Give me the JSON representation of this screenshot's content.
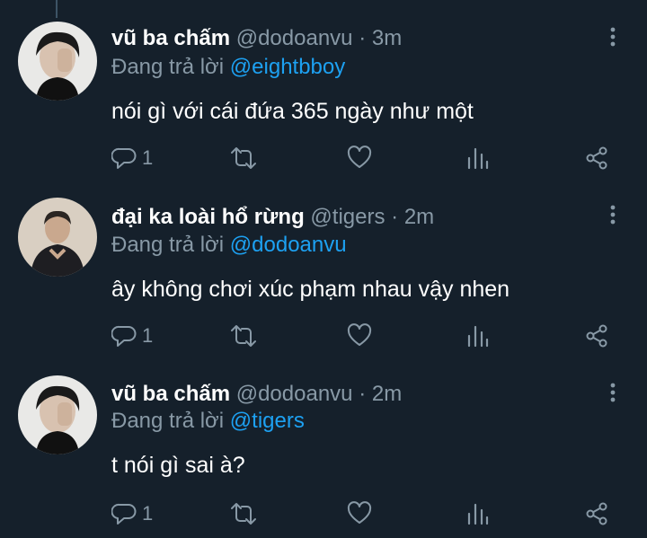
{
  "colors": {
    "background": "#15202b",
    "secondary_text": "#8899a6",
    "accent": "#1da1f2",
    "thread_line": "#3d5466"
  },
  "tweets": [
    {
      "display_name": "vũ ba chấm",
      "handle": "@dodoanvu",
      "separator": "·",
      "time": "3m",
      "reply_prefix": "Đang trả lời",
      "reply_to": "@eightbboy",
      "text": "nói gì với cái đứa 365 ngày như một",
      "reply_count": "1",
      "avatar": "avatar-man-dark-hair"
    },
    {
      "display_name": "đại ka loài hổ rừng",
      "handle": "@tigers",
      "separator": "·",
      "time": "2m",
      "reply_prefix": "Đang trả lời",
      "reply_to": "@dodoanvu",
      "text": "ây không chơi xúc phạm nhau vậy nhen",
      "reply_count": "1",
      "avatar": "avatar-man-suit"
    },
    {
      "display_name": "vũ ba chấm",
      "handle": "@dodoanvu",
      "separator": "·",
      "time": "2m",
      "reply_prefix": "Đang trả lời",
      "reply_to": "@tigers",
      "text": "t nói gì sai à?",
      "reply_count": "1",
      "avatar": "avatar-man-dark-hair"
    }
  ],
  "icons": [
    "reply-icon",
    "retweet-icon",
    "like-icon",
    "analytics-icon",
    "share-icon",
    "more-icon"
  ]
}
